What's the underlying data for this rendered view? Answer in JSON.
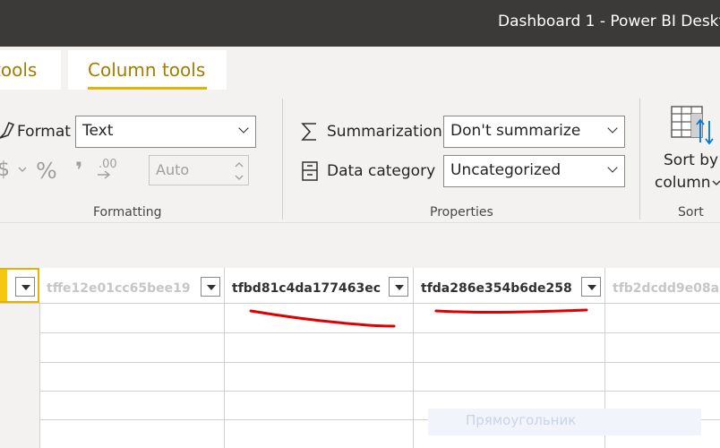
{
  "window": {
    "title": "Dashboard 1 - Power BI Deskt"
  },
  "tabs": [
    {
      "label": "tools"
    },
    {
      "label": "Column tools"
    }
  ],
  "formatting": {
    "format_label": "Format",
    "format_value": "Text",
    "currency_symbol": "$",
    "percent_symbol": "%",
    "comma_symbol": "❜",
    "decimals_symbol": ".00",
    "auto_placeholder": "Auto",
    "group_label": "Formatting"
  },
  "properties": {
    "summarization_label": "Summarization",
    "summarization_value": "Don't summarize",
    "data_category_label": "Data category",
    "data_category_value": "Uncategorized",
    "group_label": "Properties"
  },
  "sort": {
    "line1": "Sort by",
    "line2": "column",
    "group_label": "Sort"
  },
  "grid": {
    "columns": [
      {
        "name": "tffe12e01cc65bee19",
        "dimmed": true
      },
      {
        "name": "tfbd81c4da177463ec",
        "dimmed": false
      },
      {
        "name": "tfda286e354b6de258",
        "dimmed": false
      },
      {
        "name": "tfb2dcdd9e08a",
        "dimmed": true
      }
    ]
  },
  "overlay": {
    "ghost_text": "Прямоугольник"
  },
  "colors": {
    "titlebar": "#3b3a39",
    "accent": "#e0b400",
    "ribbon": "#f3f2f1",
    "annotation": "#e00000"
  }
}
